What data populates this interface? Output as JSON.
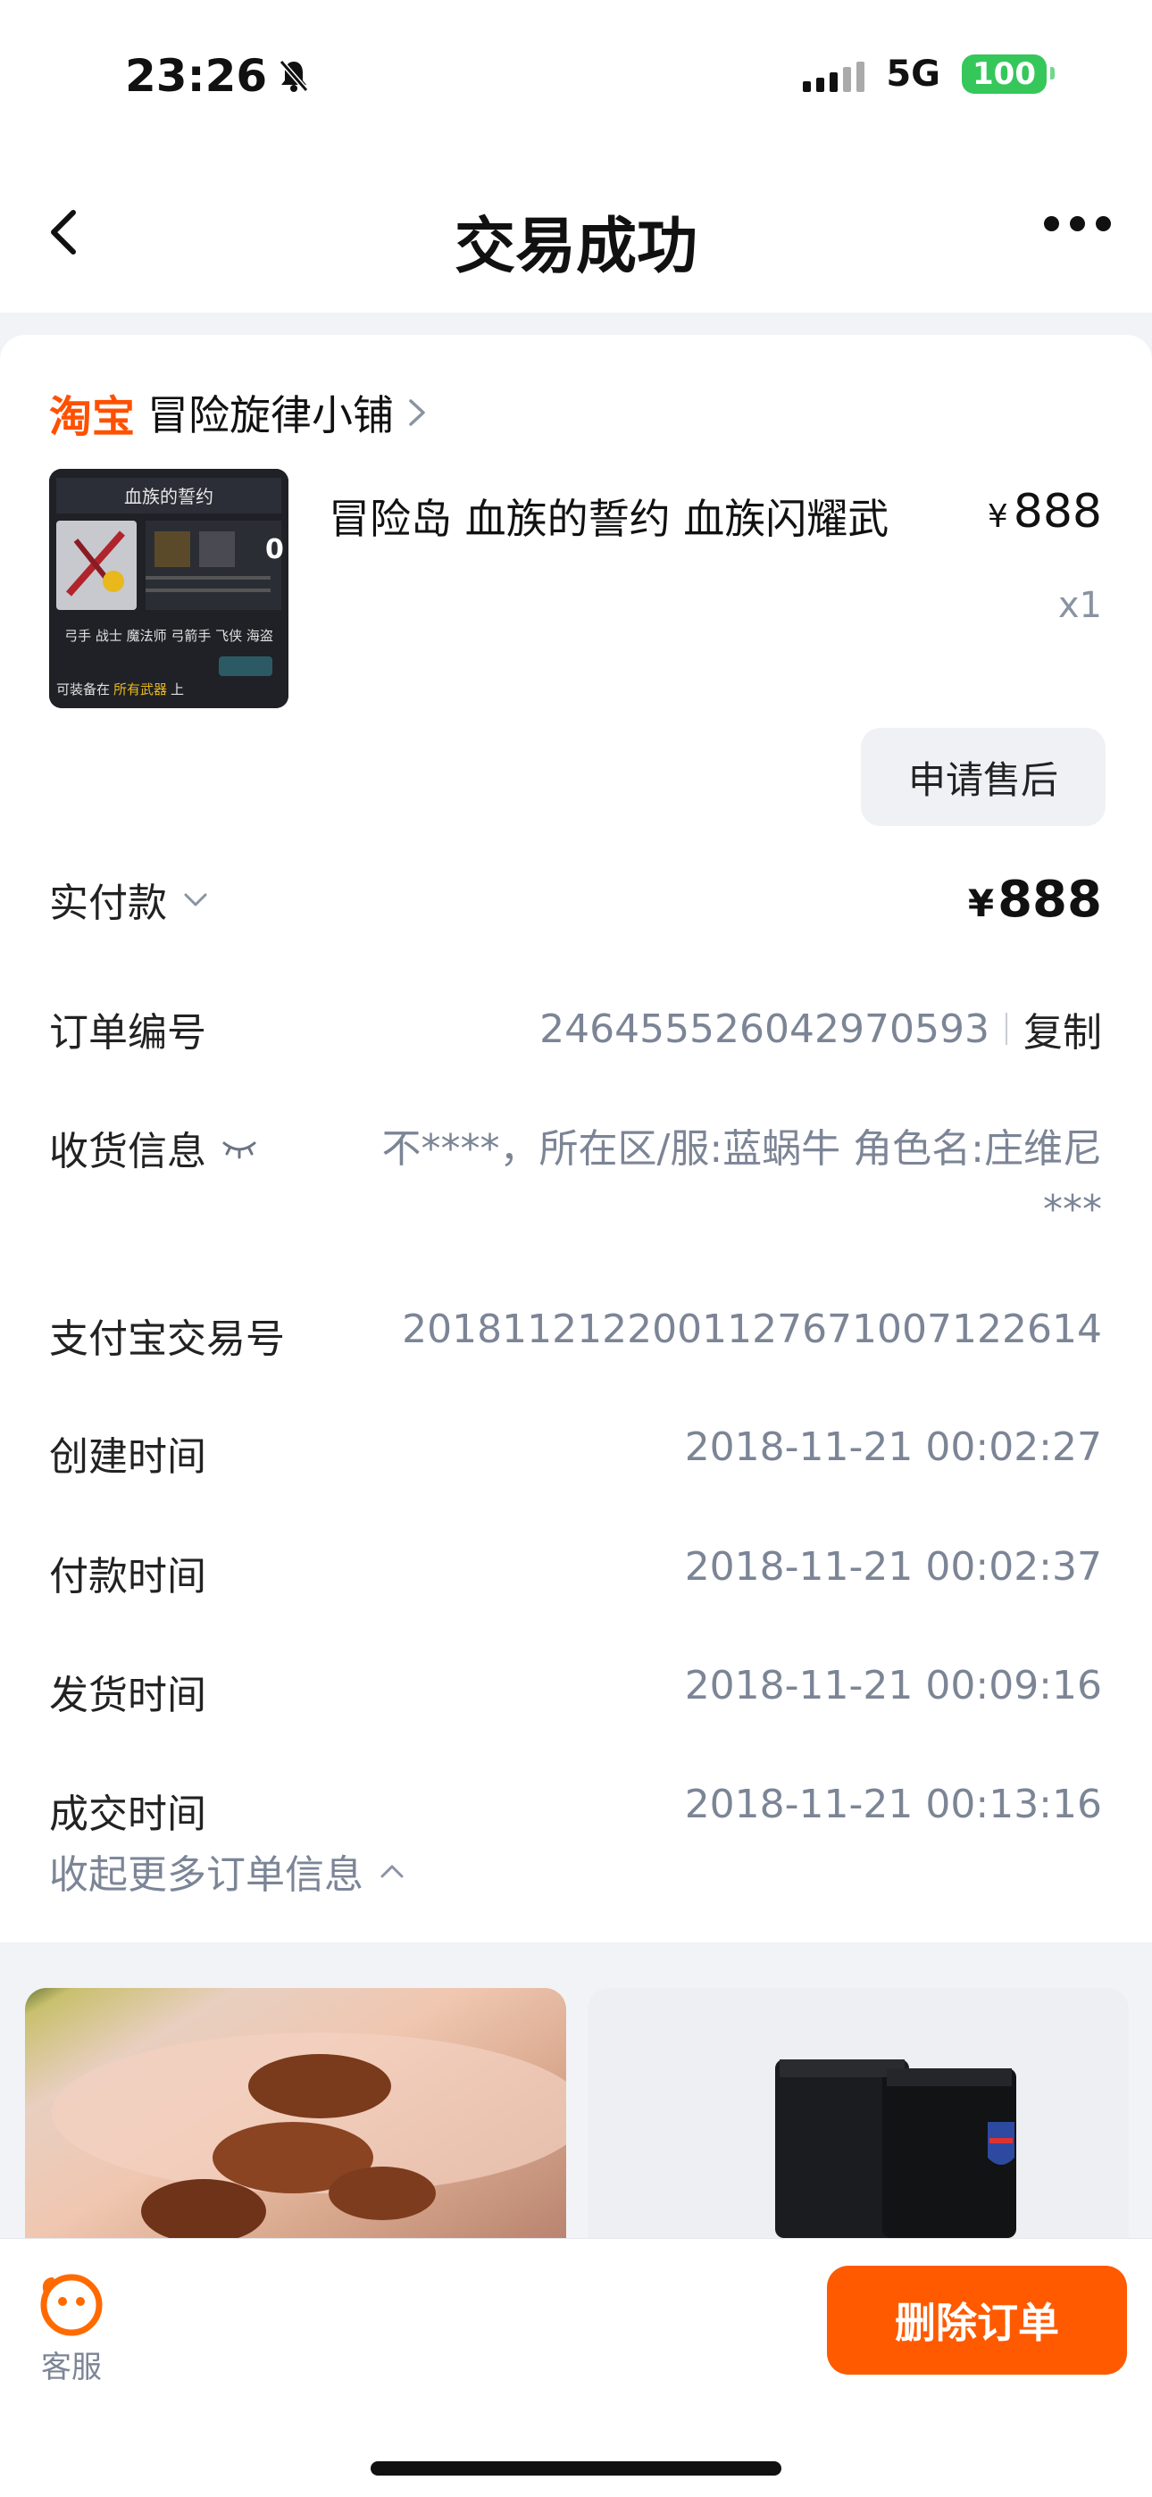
{
  "status_bar": {
    "time": "23:26",
    "network": "5G",
    "battery": "100"
  },
  "nav": {
    "title": "交易成功"
  },
  "shop": {
    "brand": "淘宝",
    "name": "冒险旋律小铺"
  },
  "product": {
    "title": "冒险岛 血族的誓约 血族闪耀武",
    "price_symbol": "¥",
    "price": "888",
    "quantity": "x1",
    "image_caption_top": "血族的誓约",
    "image_classes": "弓手 战士 魔法师 弓箭手 飞侠 海盗",
    "image_caption_bottom": "可装备在",
    "image_caption_highlight": "所有武器",
    "image_caption_end": "上",
    "image_badge": "0"
  },
  "actions": {
    "aftersale": "申请售后",
    "delete_order": "删除订单",
    "customer_service": "客服"
  },
  "payment": {
    "label": "实付款",
    "symbol": "¥",
    "amount": "888"
  },
  "order_info": {
    "order_no_label": "订单编号",
    "order_no": "2464555260429705​93",
    "copy": "复制",
    "address_label": "收货信息",
    "address_line1": "不****，所在区/服:蓝蜗牛 角色名:庄维尼",
    "address_line2": "***",
    "alipay_label": "支付宝交易号",
    "alipay_no": "2018112122001127671007122614",
    "created_label": "创建时间",
    "created": "2018-11-21 00:02:27",
    "paid_label": "付款时间",
    "paid": "2018-11-21 00:02:37",
    "shipped_label": "发货时间",
    "shipped": "2018-11-21 00:09:16",
    "closed_label": "成交时间",
    "closed": "2018-11-21 00:13:16",
    "collapse": "收起更多订单信息"
  },
  "colors": {
    "brand_orange": "#ff5000",
    "delete_button": "#ff5a00",
    "battery": "#35c75a"
  }
}
